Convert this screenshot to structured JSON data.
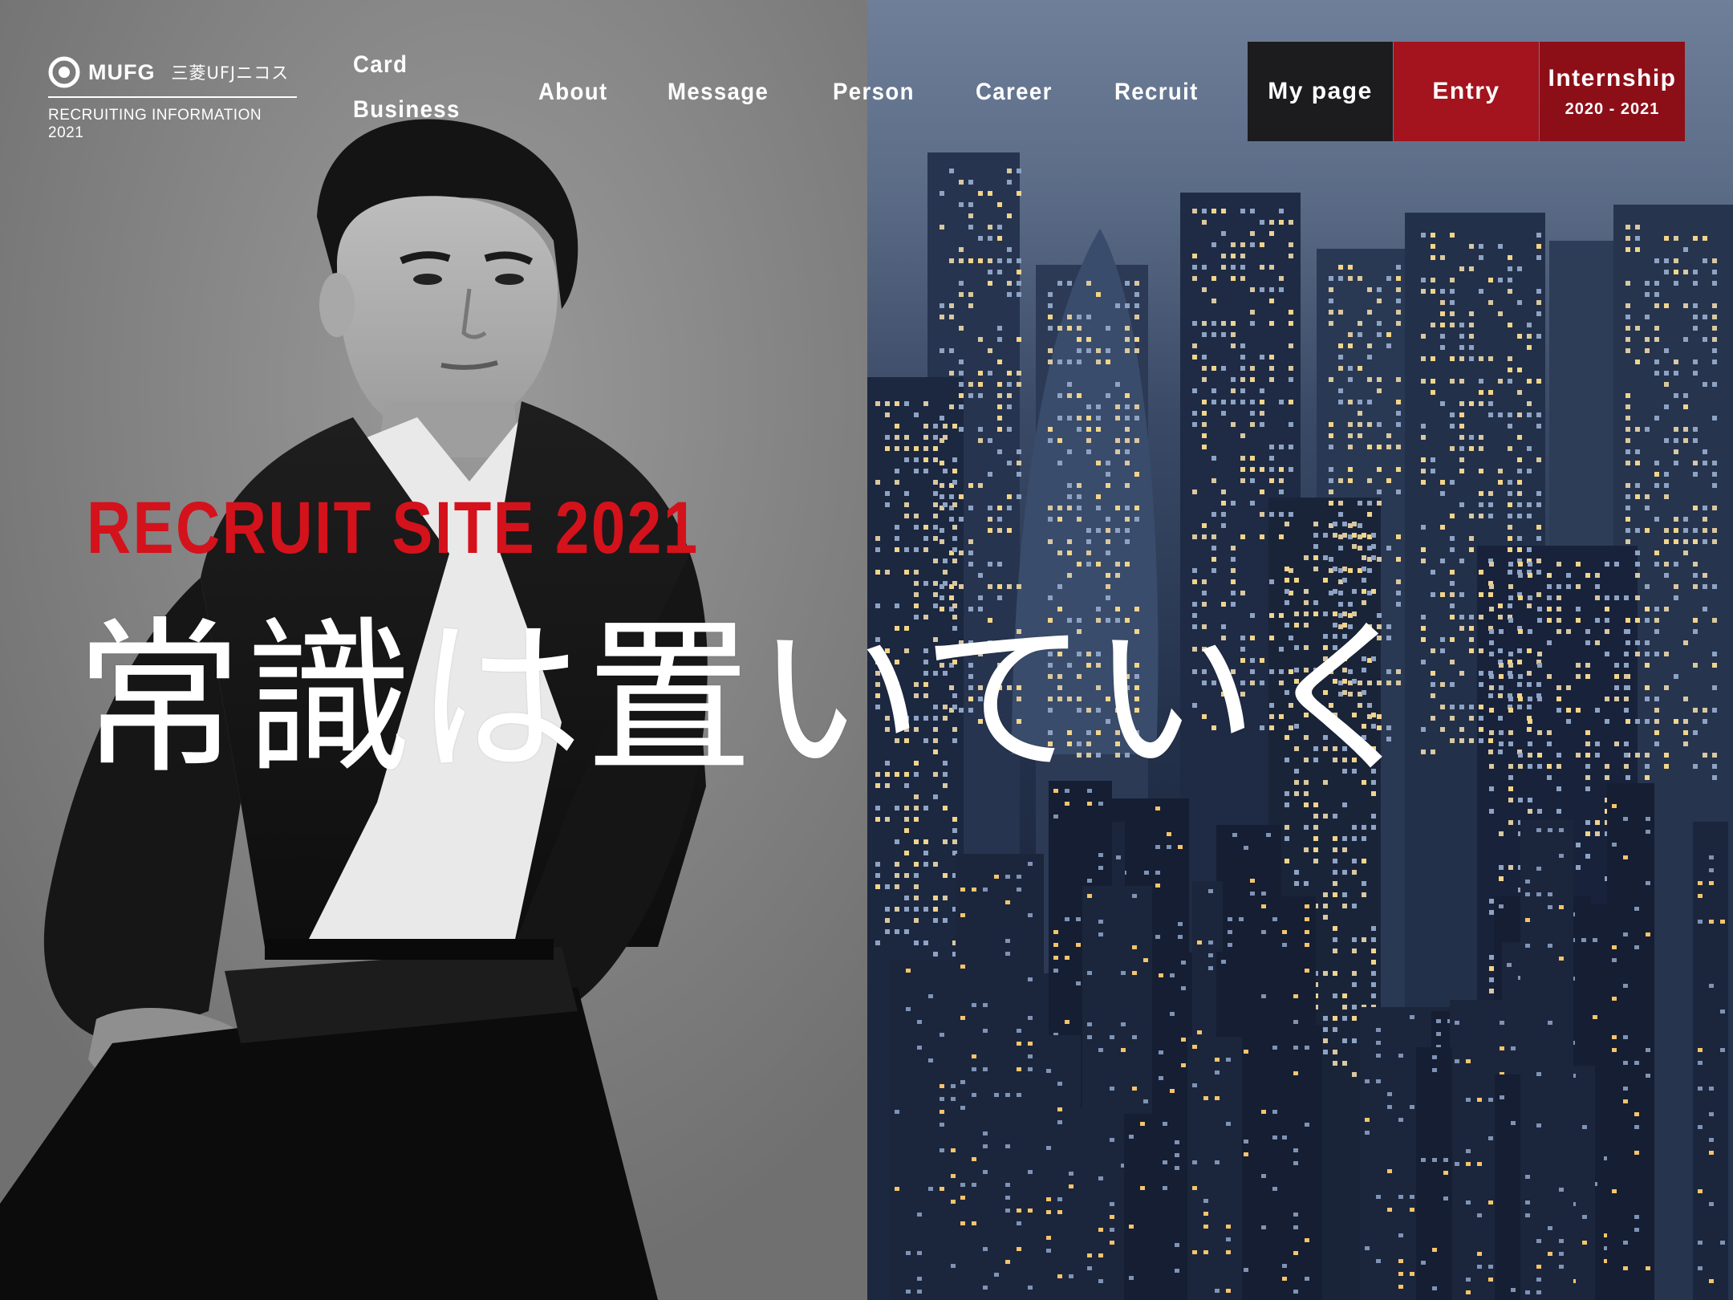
{
  "logo": {
    "brand": "MUFG",
    "company": "三菱UFJニコス",
    "subtitle": "RECRUITING INFORMATION 2021"
  },
  "nav": {
    "card_business": [
      "Card",
      "Business"
    ],
    "about": "About",
    "message": "Message",
    "person": "Person",
    "career": "Career",
    "recruit": "Recruit",
    "mypage": "My page",
    "entry": "Entry",
    "internship": "Internship",
    "internship_years": "2020 - 2021"
  },
  "hero": {
    "eyebrow": "RECRUIT SITE 2021",
    "title": "常識は置いていく"
  },
  "colors": {
    "accent_red": "#d4121c",
    "entry_bg": "#a3141e",
    "internship_bg": "#8c0f18",
    "mypage_bg": "#1c1c1e",
    "text": "#ffffff"
  }
}
